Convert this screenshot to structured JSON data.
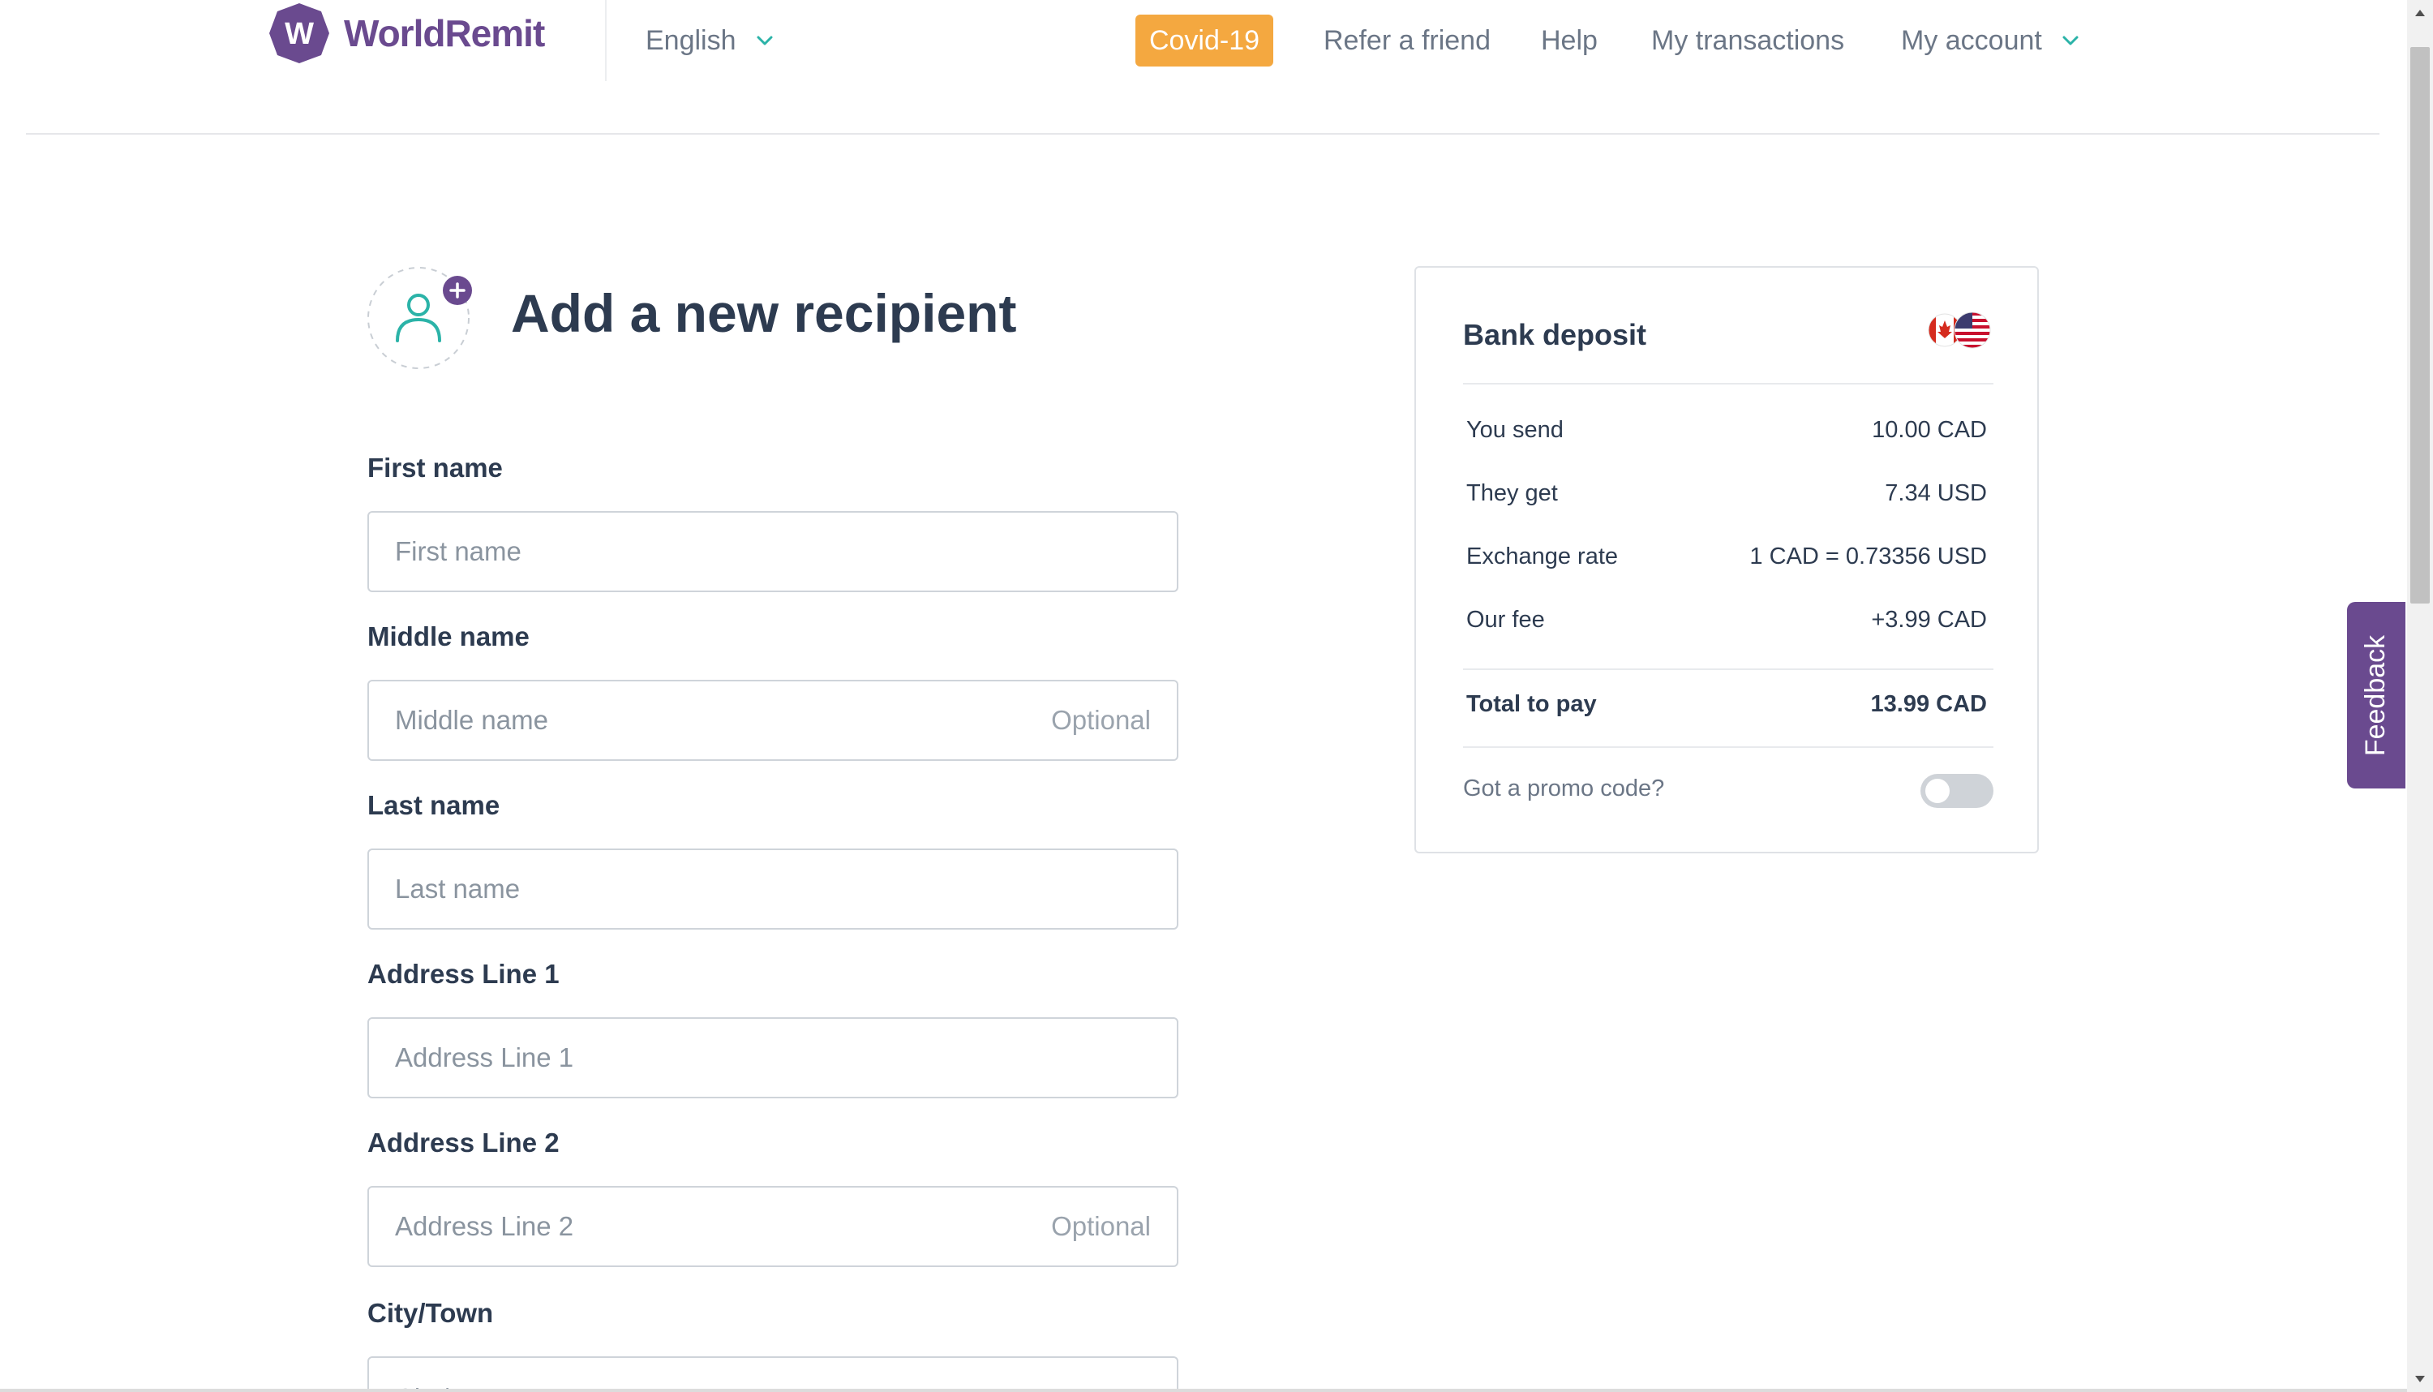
{
  "brand": {
    "name": "WorldRemit",
    "mark_letter": "W",
    "color": "#6a4a8f"
  },
  "header": {
    "language": "English",
    "covid_label": "Covid-19",
    "nav": [
      {
        "label": "Refer a friend"
      },
      {
        "label": "Help"
      },
      {
        "label": "My transactions"
      },
      {
        "label": "My account"
      }
    ]
  },
  "form": {
    "title": "Add a new recipient",
    "optional_label": "Optional",
    "fields": [
      {
        "label": "First name",
        "placeholder": "First name",
        "value": ""
      },
      {
        "label": "Middle name",
        "placeholder": "Middle name",
        "value": "",
        "optional": true
      },
      {
        "label": "Last name",
        "placeholder": "Last name",
        "value": ""
      },
      {
        "label": "Address Line 1",
        "placeholder": "Address Line 1",
        "value": ""
      },
      {
        "label": "Address Line 2",
        "placeholder": "Address Line 2",
        "value": "",
        "optional": true
      },
      {
        "label": "City/Town",
        "placeholder": "City/Town",
        "value": ""
      }
    ]
  },
  "summary": {
    "title": "Bank deposit",
    "rows": [
      {
        "label": "You send",
        "value": "10.00 CAD"
      },
      {
        "label": "They get",
        "value": "7.34 USD"
      },
      {
        "label": "Exchange rate",
        "value": "1 CAD = 0.73356 USD"
      },
      {
        "label": "Our fee",
        "value": "+3.99 CAD"
      }
    ],
    "total": {
      "label": "Total to pay",
      "value": "13.99 CAD"
    },
    "promo_label": "Got a promo code?",
    "promo_enabled": false,
    "flags": [
      "canada-flag-icon",
      "usa-flag-icon"
    ]
  },
  "feedback_label": "Feedback",
  "colors": {
    "accent_orange": "#f4a840",
    "accent_teal": "#2bb3a8",
    "text_dark": "#2d3b50",
    "text_muted": "#6b7686"
  }
}
